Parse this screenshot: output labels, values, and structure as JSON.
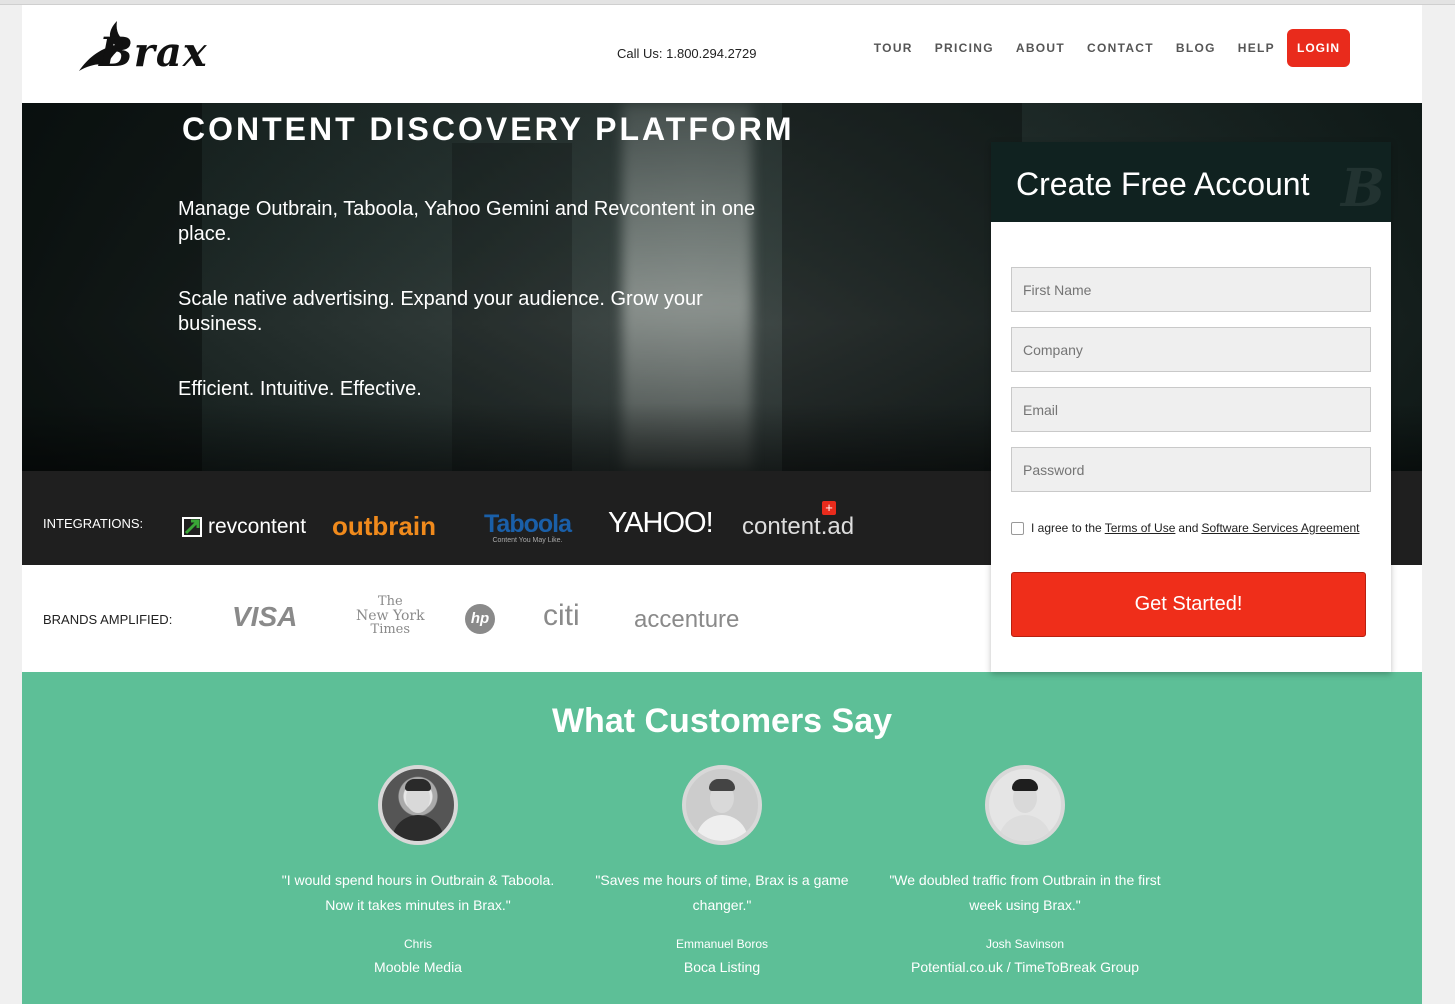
{
  "header": {
    "logo_text": "Brax",
    "call_us": "Call Us: 1.800.294.2729",
    "nav": [
      "TOUR",
      "PRICING",
      "ABOUT",
      "CONTACT",
      "BLOG",
      "HELP"
    ],
    "login_label": "LOGIN"
  },
  "hero": {
    "title": "CONTENT DISCOVERY PLATFORM",
    "paragraphs": [
      "Manage Outbrain, Taboola, Yahoo Gemini and Revcontent in one place.",
      "Scale native advertising. Expand your audience. Grow your business.",
      "Efficient. Intuitive. Effective."
    ]
  },
  "integrations": {
    "label": "INTEGRATIONS:",
    "logos": [
      "revcontent",
      "outbrain",
      "Taboola",
      "Content You May Like.",
      "YAHOO!",
      "content.ad"
    ]
  },
  "brands": {
    "label": "BRANDS AMPLIFIED:",
    "logos": [
      "VISA",
      "The",
      "New York",
      "Times",
      "hp",
      "citi",
      "accenture"
    ]
  },
  "signup": {
    "title": "Create Free Account",
    "watermark": "B",
    "fields": {
      "first_name": "First Name",
      "company": "Company",
      "email": "Email",
      "password": "Password"
    },
    "agree_prefix": "I agree to the",
    "terms_link": "Terms of Use",
    "and_text": "and",
    "agreement_link": "Software Services Agreement",
    "button": "Get Started!"
  },
  "testimonials": {
    "title": "What Customers Say",
    "items": [
      {
        "quote": "\"I would spend hours in Outbrain & Taboola. Now it takes minutes in Brax.\"",
        "name": "Chris",
        "company": "Mooble Media"
      },
      {
        "quote": "\"Saves me hours of time, Brax is a game changer.\"",
        "name": "Emmanuel Boros",
        "company": "Boca Listing"
      },
      {
        "quote": "\"We doubled traffic from Outbrain in the first week using Brax.\"",
        "name": "Josh Savinson",
        "company": "Potential.co.uk / TimeToBreak Group"
      }
    ]
  },
  "colors": {
    "accent_red": "#e92b1c",
    "testimonial_green": "#5dbf97",
    "card_header": "#102220",
    "outbrain_orange": "#f08a1c",
    "revcontent_green": "#3aa537",
    "taboola_blue": "#1a5fa8"
  }
}
